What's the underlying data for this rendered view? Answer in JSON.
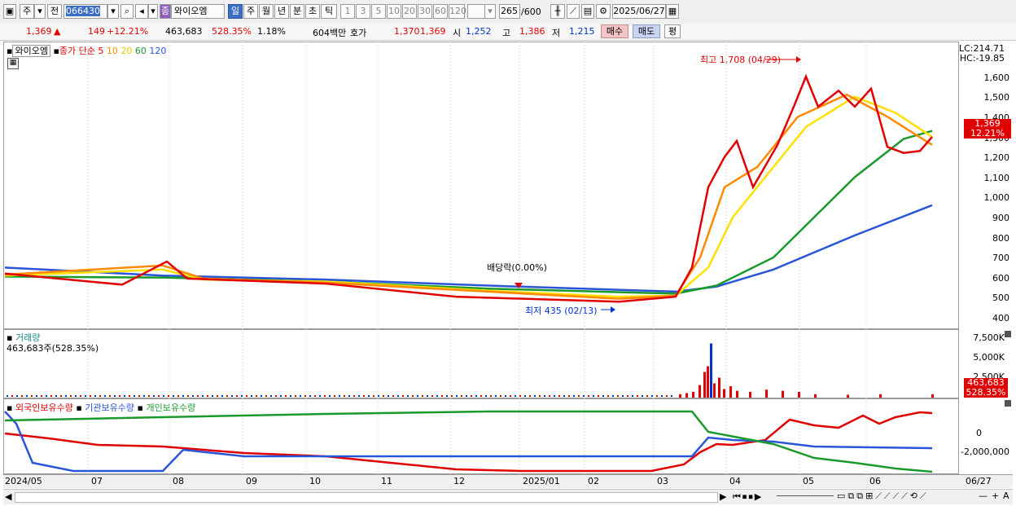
{
  "toolbar": {
    "market_label": "주",
    "prev_label": "전",
    "code": "066430",
    "stock_name": "와이오엠",
    "period_day": "일",
    "period_week": "주",
    "period_month": "월",
    "period_year": "년",
    "period_min": "분",
    "period_sec": "초",
    "period_tick": "틱",
    "num_1": "1",
    "num_3": "3",
    "num_5": "5",
    "num_10": "10",
    "num_20": "20",
    "num_30": "30",
    "num_60": "60",
    "num_120": "120",
    "count": "265",
    "count_total": "/600",
    "date": "2025/06/27",
    "badge_label": "종"
  },
  "quote": {
    "price": "1,369",
    "change": "149",
    "change_pct": "+12.21%",
    "volume": "463,683",
    "vol_ratio": "528.35%",
    "turnover": "1.18%",
    "amount": "604백만",
    "ask_label": "호가",
    "ask_val": "1,370",
    "bid_val": "1,369",
    "open_label": "시",
    "open_val": "1,252",
    "high_label": "고",
    "high_val": "1,386",
    "low_label": "저",
    "low_val": "1,215",
    "buy_label": "매수",
    "sell_label": "매도",
    "eval_label": "평"
  },
  "price_pane": {
    "name": "와이오엠",
    "ma_label": "종가 단순",
    "ma_5": "5",
    "ma_10": "10",
    "ma_20": "20",
    "ma_60": "60",
    "ma_120": "120",
    "lc": "LC:214.71",
    "hc": "HC:-19.85",
    "high_annotation": "최고 1,708 (04/29)",
    "low_annotation": "최저 435 (02/13)",
    "dividend_annotation": "배당락(0.00%)",
    "current_price_tag": "1,369",
    "current_pct_tag": "12.21%",
    "y_ticks": [
      "1,600",
      "1,500",
      "1,400",
      "1,300",
      "1,200",
      "1,100",
      "1,000",
      "900",
      "800",
      "700",
      "600",
      "500",
      "400"
    ]
  },
  "volume_pane": {
    "title": "거래량",
    "summary": "463,683주(528.35%)",
    "y_ticks": [
      "7,500K",
      "5,000K",
      "2,500K"
    ],
    "tag_value": "463,683",
    "tag_pct": "528.35%"
  },
  "holdings_pane": {
    "foreign": "외국인보유수량",
    "inst": "기관보유수량",
    "indiv": "개인보유수량",
    "y_ticks": [
      "0",
      "-2,000,000"
    ]
  },
  "x_axis": [
    "2024/05",
    "07",
    "08",
    "09",
    "10",
    "11",
    "12",
    "2025/01",
    "02",
    "03",
    "04",
    "05",
    "06",
    "06/27"
  ],
  "colors": {
    "ma5": "#e00000",
    "ma10": "#ff8a00",
    "ma20": "#ffe000",
    "ma60": "#1a9a2a",
    "ma120": "#2a55d8",
    "up": "#e00000",
    "down": "#0033cc"
  }
}
